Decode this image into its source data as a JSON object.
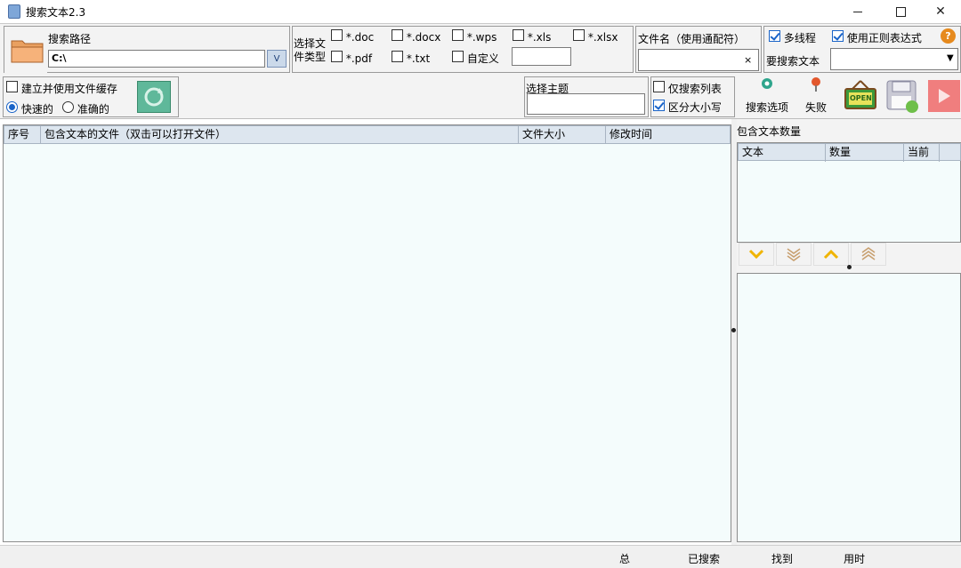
{
  "window": {
    "title": "搜索文本2.3"
  },
  "search_path": {
    "label": "搜索路径",
    "value": "C:\\"
  },
  "file_types": {
    "label_line1": "选择文",
    "label_line2": "件类型",
    "options": [
      {
        "label": "*.doc",
        "checked": false
      },
      {
        "label": "*.docx",
        "checked": false
      },
      {
        "label": "*.wps",
        "checked": false
      },
      {
        "label": "*.xls",
        "checked": false
      },
      {
        "label": "*.xlsx",
        "checked": false
      },
      {
        "label": "*.pdf",
        "checked": false
      },
      {
        "label": "*.txt",
        "checked": false
      },
      {
        "label": "自定义",
        "checked": false
      }
    ],
    "custom_value": ""
  },
  "filename": {
    "label": "文件名（使用通配符）",
    "value": "",
    "clear": "×"
  },
  "options": {
    "multithread": {
      "label": "多线程",
      "checked": true
    },
    "regex": {
      "label": "使用正则表达式",
      "checked": true
    },
    "search_text_label": "要搜索文本",
    "search_text_value": "",
    "help": "?"
  },
  "cache": {
    "label": "建立并使用文件缓存",
    "checked": false,
    "fast": "快速的",
    "accurate": "准确的"
  },
  "theme": {
    "label": "选择主题",
    "value": ""
  },
  "search_flags": {
    "list_only": {
      "label": "仅搜索列表",
      "checked": false
    },
    "case": {
      "label": "区分大小写",
      "checked": true
    }
  },
  "toolbar": {
    "search_options": "搜索选项",
    "failed": "失败",
    "open_icon_text": "OPEN"
  },
  "results_table": {
    "columns": [
      "序号",
      "包含文本的文件（双击可以打开文件）",
      "文件大小",
      "修改时间"
    ]
  },
  "count_table": {
    "title": "包含文本数量",
    "columns": [
      "文本",
      "数量",
      "当前"
    ]
  },
  "statusbar": {
    "total": "总",
    "searched": "已搜索",
    "found": "找到",
    "elapsed": "用时"
  },
  "colors": {
    "accent": "#1a64c8",
    "panel_bg": "#f4fcfc",
    "header_bg": "#dde6ef"
  }
}
